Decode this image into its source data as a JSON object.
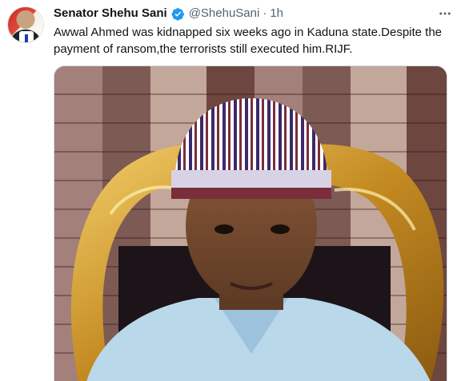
{
  "tweet": {
    "author": {
      "display_name": "Senator Shehu Sani",
      "handle": "@ShehuSani",
      "verified": true
    },
    "separator": "·",
    "timestamp": "1h",
    "more_icon": "more-horizontal-icon",
    "text": "Awwal Ahmed was kidnapped six weeks ago in Kaduna state.Despite the payment of ransom,the terrorists still executed him.RIJF.",
    "media": {
      "kind": "photo"
    }
  },
  "colors": {
    "text_primary": "#0f1419",
    "text_secondary": "#536471",
    "verified_blue": "#1d9bf0"
  }
}
